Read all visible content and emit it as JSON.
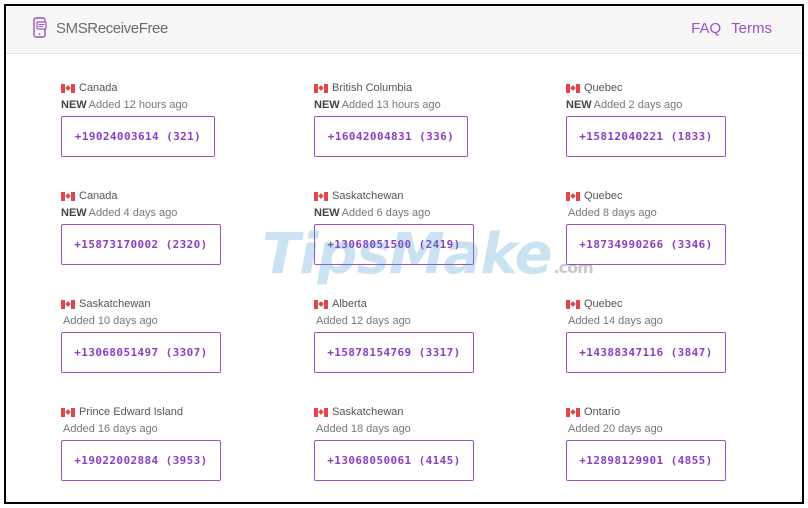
{
  "header": {
    "brand": "SMSReceiveFree",
    "nav": {
      "faq": "FAQ",
      "terms": "Terms"
    }
  },
  "cards": [
    {
      "country": "Canada",
      "is_new": true,
      "new_label": "NEW",
      "added": "Added 12 hours ago",
      "number": "+19024003614 (321)"
    },
    {
      "country": "British Columbia",
      "is_new": true,
      "new_label": "NEW",
      "added": "Added 13 hours ago",
      "number": "+16042004831 (336)"
    },
    {
      "country": "Quebec",
      "is_new": true,
      "new_label": "NEW",
      "added": "Added 2 days ago",
      "number": "+15812040221 (1833)"
    },
    {
      "country": "Canada",
      "is_new": true,
      "new_label": "NEW",
      "added": "Added 4 days ago",
      "number": "+15873170002 (2320)"
    },
    {
      "country": "Saskatchewan",
      "is_new": true,
      "new_label": "NEW",
      "added": "Added 6 days ago",
      "number": "+13068051500 (2419)"
    },
    {
      "country": "Quebec",
      "is_new": false,
      "new_label": "",
      "added": "Added 8 days ago",
      "number": "+18734990266 (3346)"
    },
    {
      "country": "Saskatchewan",
      "is_new": false,
      "new_label": "",
      "added": "Added 10 days ago",
      "number": "+13068051497 (3307)"
    },
    {
      "country": "Alberta",
      "is_new": false,
      "new_label": "",
      "added": "Added 12 days ago",
      "number": "+15878154769 (3317)"
    },
    {
      "country": "Quebec",
      "is_new": false,
      "new_label": "",
      "added": "Added 14 days ago",
      "number": "+14388347116 (3847)"
    },
    {
      "country": "Prince Edward Island",
      "is_new": false,
      "new_label": "",
      "added": "Added 16 days ago",
      "number": "+19022002884 (3953)"
    },
    {
      "country": "Saskatchewan",
      "is_new": false,
      "new_label": "",
      "added": "Added 18 days ago",
      "number": "+13068050061 (4145)"
    },
    {
      "country": "Ontario",
      "is_new": false,
      "new_label": "",
      "added": "Added 20 days ago",
      "number": "+12898129901 (4855)"
    }
  ],
  "watermark": {
    "main": "TipsMake",
    "suffix": ".com"
  },
  "colors": {
    "accent": "#9c4fc9",
    "flag_red": "#e0474c"
  },
  "icons": {
    "brand": "phone-icon",
    "flag": "canada-flag-icon"
  }
}
